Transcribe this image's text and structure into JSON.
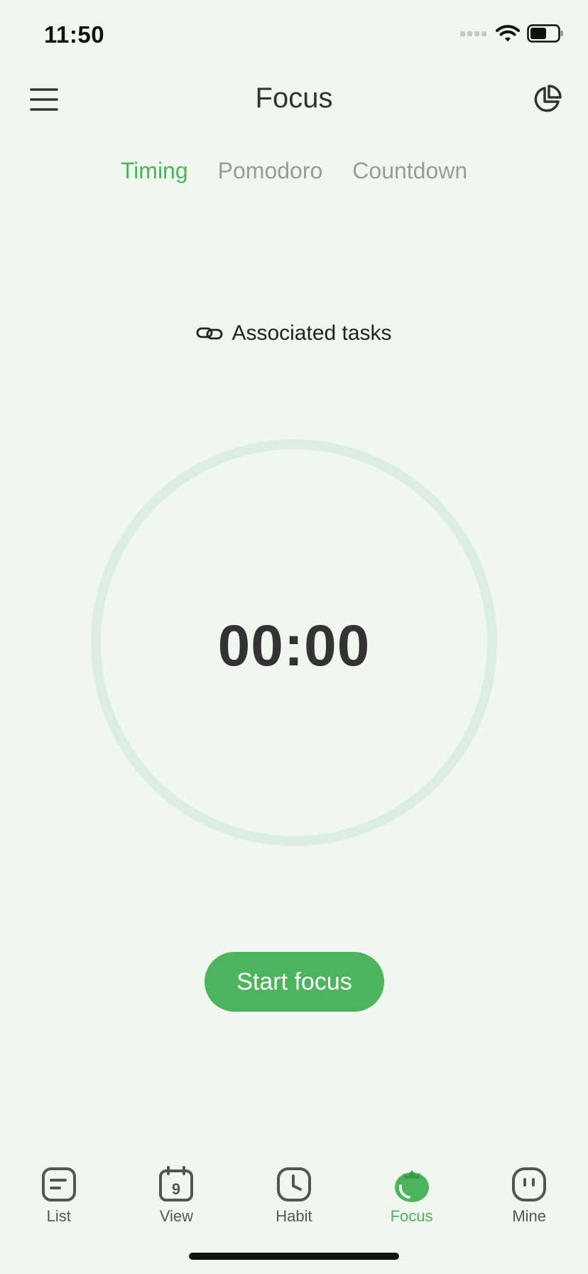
{
  "status_bar": {
    "time": "11:50",
    "icons": [
      "signal-icon",
      "wifi-icon",
      "battery-icon"
    ]
  },
  "header": {
    "title": "Focus",
    "menu_icon": "menu-icon",
    "stats_icon": "pie-chart-icon"
  },
  "mode_tabs": [
    {
      "label": "Timing",
      "active": true
    },
    {
      "label": "Pomodoro",
      "active": false
    },
    {
      "label": "Countdown",
      "active": false
    }
  ],
  "associated": {
    "icon": "link-icon",
    "label": "Associated tasks"
  },
  "timer": {
    "value": "00:00"
  },
  "start_button": {
    "label": "Start focus"
  },
  "tab_bar": [
    {
      "label": "List",
      "icon": "list-icon",
      "active": false
    },
    {
      "label": "View",
      "icon": "calendar-icon",
      "icon_text": "9",
      "active": false
    },
    {
      "label": "Habit",
      "icon": "clock-icon",
      "active": false
    },
    {
      "label": "Focus",
      "icon": "tomato-icon",
      "active": true
    },
    {
      "label": "Mine",
      "icon": "face-icon",
      "active": false
    }
  ],
  "colors": {
    "background": "#f0f7ee",
    "accent": "#4cb45c",
    "ring": "#dceee3",
    "inactive_text": "#9b9b9b"
  }
}
